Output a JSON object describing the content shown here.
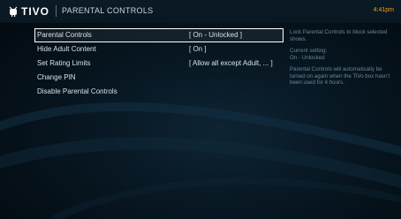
{
  "header": {
    "brand": "TIVO",
    "title": "PARENTAL CONTROLS",
    "clock": "4:41pm"
  },
  "menu": {
    "items": [
      {
        "label": "Parental Controls",
        "value": "[ On - Unlocked ]"
      },
      {
        "label": "Hide Adult Content",
        "value": "[ On ]"
      },
      {
        "label": "Set Rating Limits",
        "value": "[ Allow all except Adult, ... ]"
      },
      {
        "label": "Change PIN",
        "value": ""
      },
      {
        "label": "Disable Parental Controls",
        "value": ""
      }
    ]
  },
  "info": {
    "description": "Lock Parental Controls to block selected shows.",
    "current_setting_label": "Current setting:",
    "current_setting_value": "On - Unlocked",
    "note": "Parental Controls will automatically be turned on again when the TiVo box hasn't been used for 4 hours."
  }
}
